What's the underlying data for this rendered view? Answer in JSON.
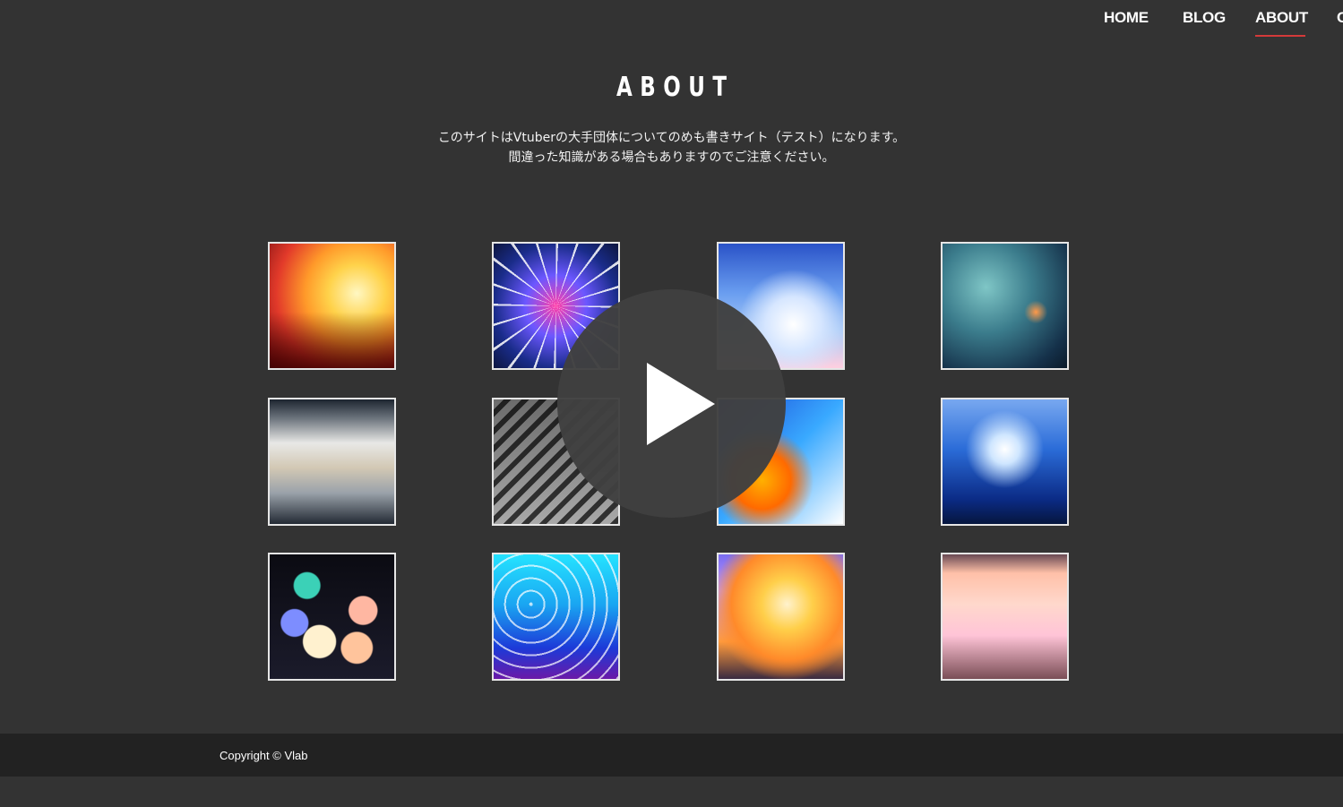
{
  "nav": {
    "items": [
      {
        "label": "HOME"
      },
      {
        "label": "BLOG"
      },
      {
        "label": "ABOUT",
        "active": true
      },
      {
        "label": "C"
      }
    ],
    "active_color": "#d43a3a"
  },
  "main": {
    "title": "ABOUT",
    "description_line1": "このサイトはVtuberの大手団体についてのめも書きサイト（テスト）になります。",
    "description_line2": "間違った知識がある場合もありますのでご注意ください。"
  },
  "gallery": {
    "tile_count": 12,
    "tiles": [
      {
        "icon": "photo-city-rail-sunset"
      },
      {
        "icon": "photo-ferris-wheel-lights"
      },
      {
        "icon": "photo-sky-city"
      },
      {
        "icon": "photo-tokyo-tower-night"
      },
      {
        "icon": "photo-foggy-skyline"
      },
      {
        "icon": "photo-crosswalk-fisheye"
      },
      {
        "icon": "photo-orange-flowers-blue"
      },
      {
        "icon": "photo-bridge-fisheye"
      },
      {
        "icon": "photo-bokeh-lights"
      },
      {
        "icon": "photo-cyan-city"
      },
      {
        "icon": "photo-golden-street"
      },
      {
        "icon": "photo-pink-sky-inverted-city"
      }
    ],
    "overlay": {
      "icon": "play-icon"
    }
  },
  "footer": {
    "copyright": "Copyright © Vlab"
  },
  "colors": {
    "background": "#333333",
    "footer_background": "#222222",
    "text": "#ffffff",
    "accent": "#d43a3a"
  }
}
